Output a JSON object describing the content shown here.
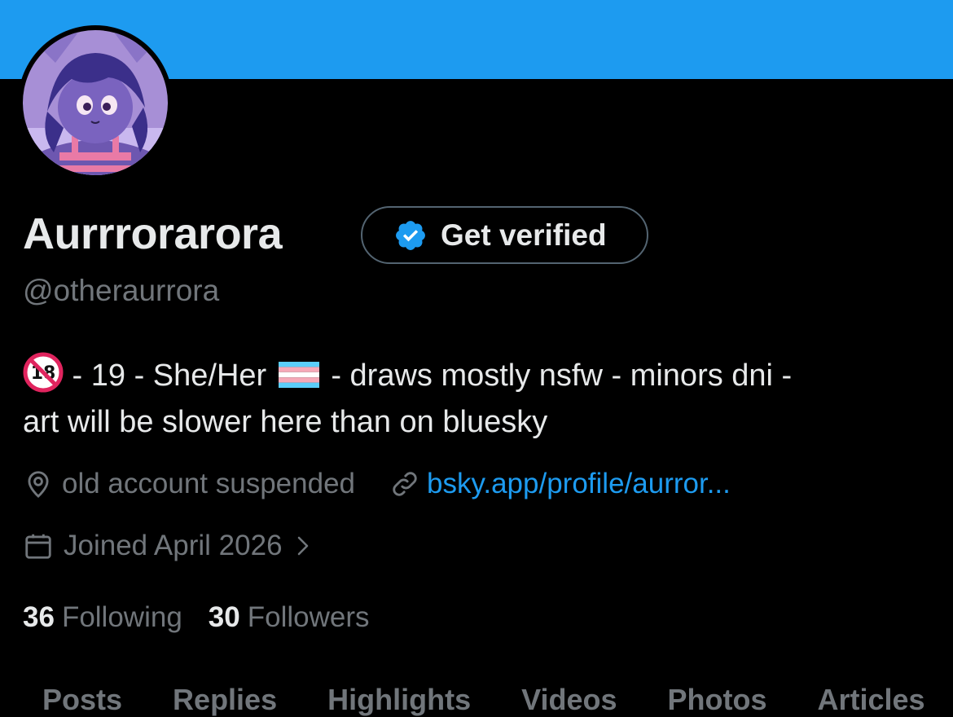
{
  "colors": {
    "banner": "#1d9bf0",
    "background": "#000000",
    "primary_text": "#e7e9ea",
    "secondary_text": "#71767b",
    "link": "#1d9bf0",
    "verified_badge": "#1d9bf0"
  },
  "profile": {
    "display_name": "Aurrrorarora",
    "handle": "@otheraurrora",
    "get_verified_label": "Get verified",
    "bio_line1_part1": " - 19 - She/Her ",
    "bio_line1_part2": " - draws mostly nsfw - minors dni -",
    "bio_line2": "art will be slower here than on bluesky",
    "location": "old account suspended",
    "website": "bsky.app/profile/aurror...",
    "joined": "Joined April 2026"
  },
  "icons": {
    "avatar": "avatar-image",
    "age": "no-one-under-18-icon",
    "flag": "transgender-flag-icon",
    "badge": "verified-badge-icon",
    "location": "location-pin-icon",
    "link": "link-icon",
    "calendar": "calendar-icon",
    "chevron": "chevron-right-icon"
  },
  "stats": {
    "following_count": "36",
    "following_label": "Following",
    "followers_count": "30",
    "followers_label": "Followers"
  },
  "tabs": [
    "Posts",
    "Replies",
    "Highlights",
    "Videos",
    "Photos",
    "Articles"
  ]
}
